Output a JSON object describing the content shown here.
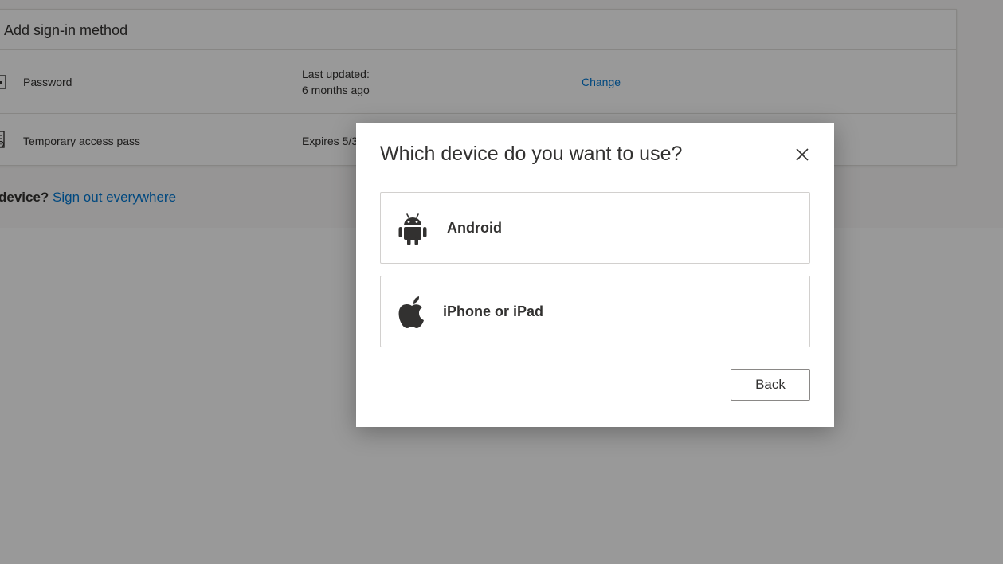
{
  "background": {
    "add_method_label": "Add sign-in method",
    "methods": [
      {
        "name": "Password",
        "detail_line1": "Last updated:",
        "detail_line2": "6 months ago",
        "action": "Change",
        "icon": "password-icon"
      },
      {
        "name": "Temporary access pass",
        "detail_line1": "Expires 5/3",
        "detail_line2": "",
        "action": "",
        "icon": "access-pass-icon"
      }
    ],
    "lost_device_question": "device?",
    "sign_out_link": "Sign out everywhere"
  },
  "dialog": {
    "title": "Which device do you want to use?",
    "close_icon": "close-icon",
    "options": [
      {
        "label": "Android",
        "icon": "android-icon"
      },
      {
        "label": "iPhone or iPad",
        "icon": "apple-icon"
      }
    ],
    "back_label": "Back"
  },
  "colors": {
    "link": "#0078d4",
    "text": "#323130",
    "overlay": "rgba(0,0,0,0.40)",
    "border": "#d2d0ce"
  }
}
